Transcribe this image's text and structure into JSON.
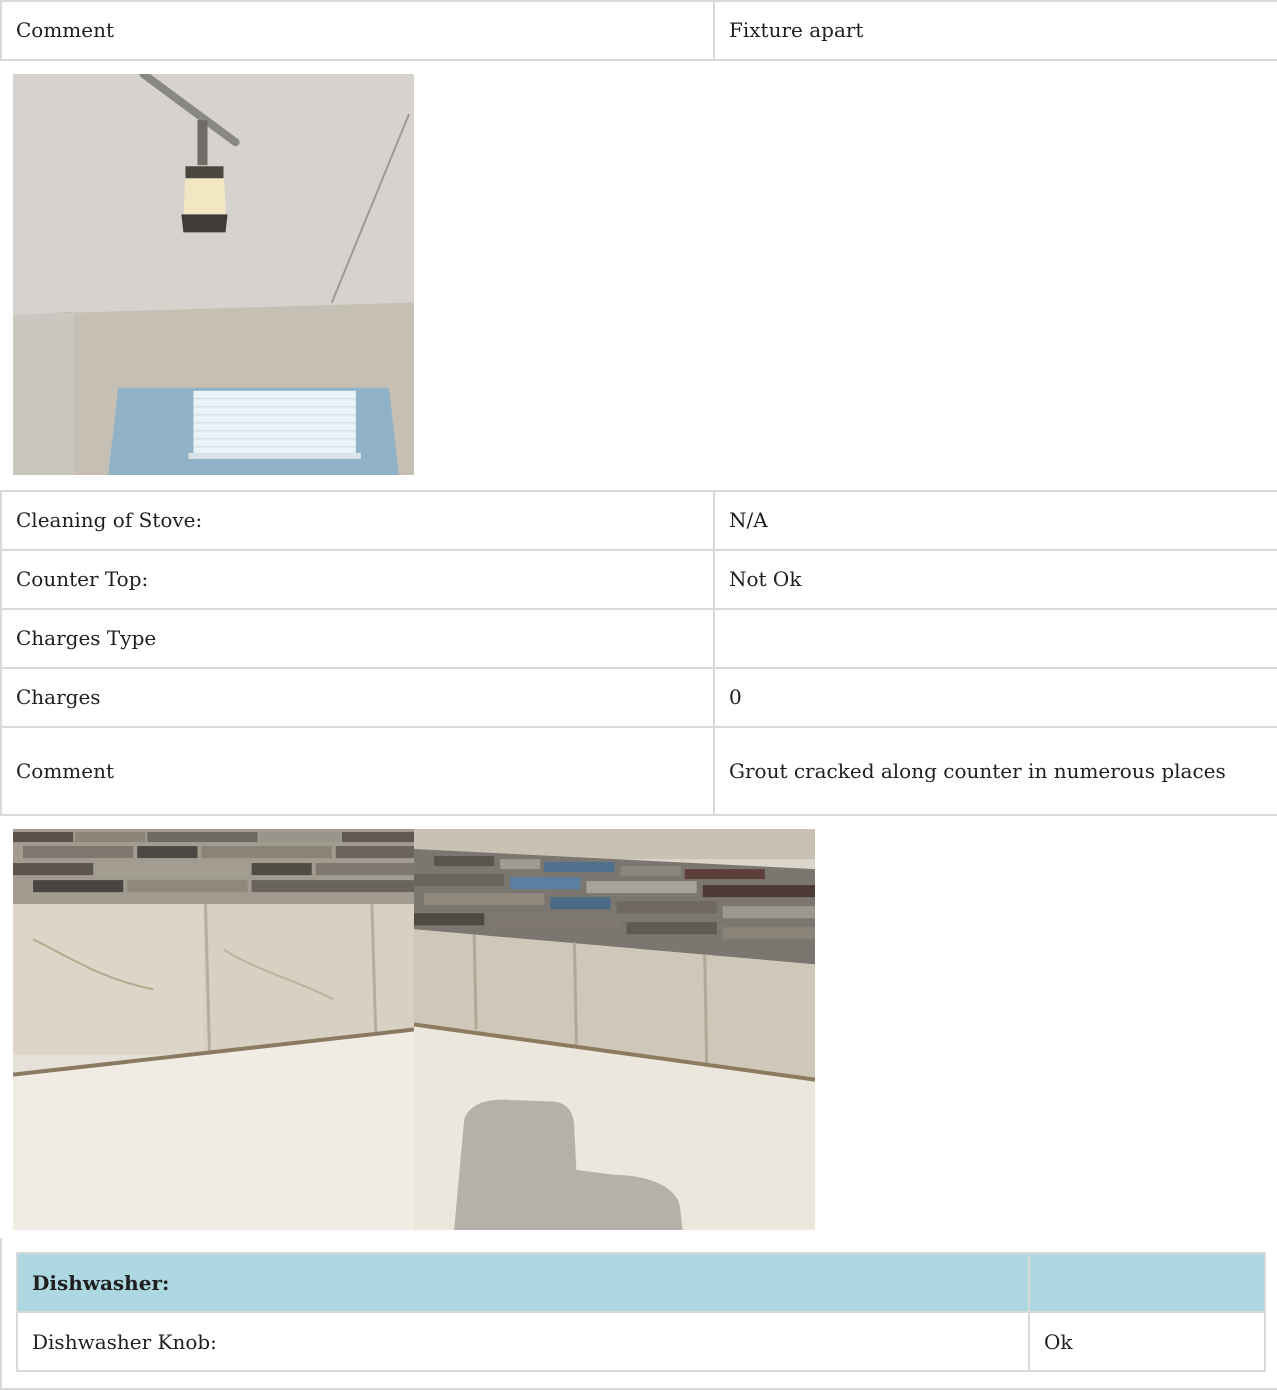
{
  "rows_top": [
    {
      "label": "Comment",
      "value": "Fixture apart"
    }
  ],
  "rows_counter": [
    {
      "label": "Cleaning of Stove:",
      "value": "N/A"
    },
    {
      "label": "Counter Top:",
      "value": "Not Ok"
    },
    {
      "label": "Charges Type",
      "value": ""
    },
    {
      "label": "Charges",
      "value": "0"
    },
    {
      "label": "Comment",
      "value": "Grout cracked along counter in numerous places"
    }
  ],
  "dishwasher": {
    "heading": "Dishwasher:",
    "heading_value": "",
    "rows": [
      {
        "label": "Dishwasher Knob:",
        "value": "Ok"
      }
    ]
  },
  "colors": {
    "border": "#d9d9d9",
    "section_header_bg": "#add8e2"
  }
}
